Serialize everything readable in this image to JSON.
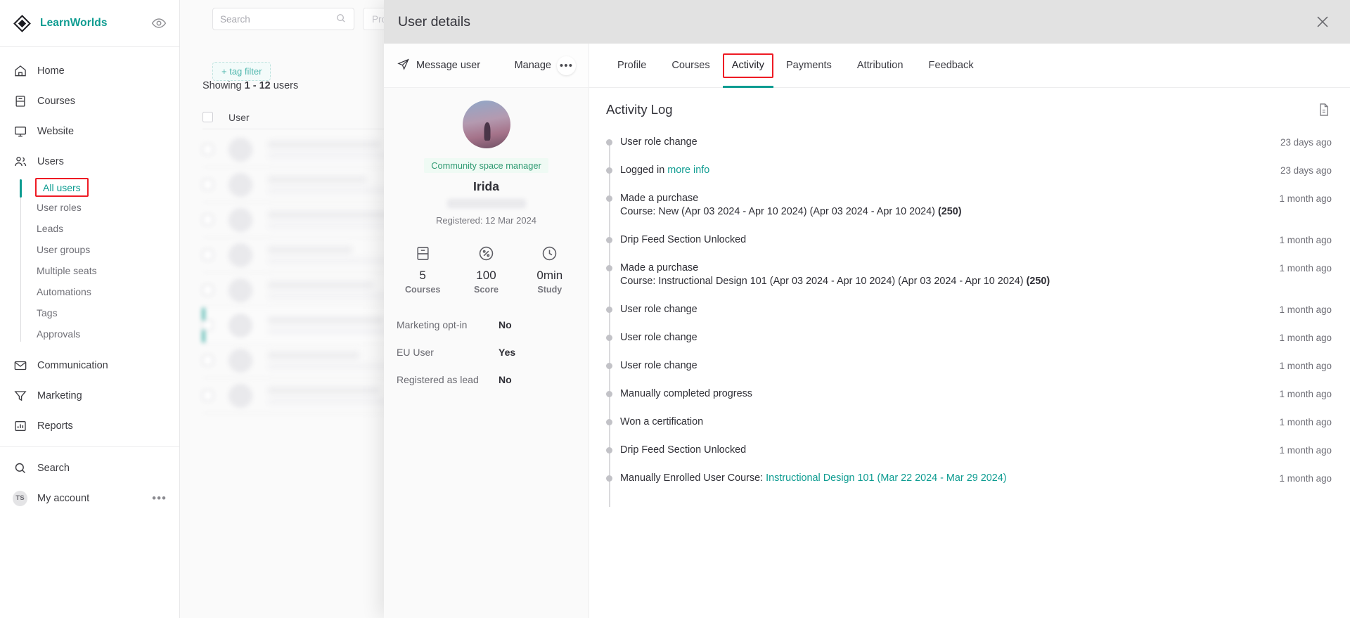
{
  "brand": {
    "name": "LearnWorlds",
    "logo_icon": "learnworlds-logo-icon",
    "preview_icon": "eye-icon",
    "accent": "#0e9c91"
  },
  "sidebar": {
    "items": [
      {
        "label": "Home",
        "icon": "home-icon"
      },
      {
        "label": "Courses",
        "icon": "book-icon"
      },
      {
        "label": "Website",
        "icon": "monitor-icon"
      },
      {
        "label": "Users",
        "icon": "users-icon"
      }
    ],
    "user_subitems": [
      {
        "label": "All users",
        "active": true,
        "highlighted": true
      },
      {
        "label": "User roles"
      },
      {
        "label": "Leads"
      },
      {
        "label": "User groups"
      },
      {
        "label": "Multiple seats"
      },
      {
        "label": "Automations"
      },
      {
        "label": "Tags"
      },
      {
        "label": "Approvals"
      }
    ],
    "items_bottom": [
      {
        "label": "Communication",
        "icon": "envelope-icon"
      },
      {
        "label": "Marketing",
        "icon": "funnel-icon"
      },
      {
        "label": "Reports",
        "icon": "bar-chart-icon"
      }
    ],
    "items_footer": [
      {
        "label": "Search",
        "icon": "search-icon"
      }
    ],
    "account": {
      "label": "My account",
      "initials": "TS",
      "more_icon": "ellipsis-icon"
    }
  },
  "background": {
    "search_placeholder": "Search",
    "search_icon": "search-icon",
    "filter_pill": "Pro",
    "tag_filter": "+ tag filter",
    "showing_prefix": "Showing ",
    "showing_count": "1 - 12",
    "showing_suffix": " users",
    "column_user": "User"
  },
  "panel": {
    "title": "User details",
    "close_icon": "close-icon",
    "message_user": "Message user",
    "message_icon": "send-icon",
    "manage": "Manage",
    "manage_dots": "•••"
  },
  "profile": {
    "avatar_name": "user-avatar",
    "role_badge": "Community space manager",
    "name": "Irida",
    "registered": "Registered: 12 Mar 2024",
    "stats": [
      {
        "value": "5",
        "label": "Courses",
        "icon": "book-icon"
      },
      {
        "value": "100",
        "label": "Score",
        "icon": "percent-circle-icon"
      },
      {
        "value": "0min",
        "label": "Study",
        "icon": "clock-icon"
      }
    ],
    "fields": [
      {
        "key": "Marketing opt-in",
        "value": "No"
      },
      {
        "key": "EU User",
        "value": "Yes"
      },
      {
        "key": "Registered as lead",
        "value": "No"
      }
    ]
  },
  "tabs": [
    {
      "label": "Profile",
      "active": false,
      "highlighted": false
    },
    {
      "label": "Courses",
      "active": false,
      "highlighted": false
    },
    {
      "label": "Activity",
      "active": true,
      "highlighted": true
    },
    {
      "label": "Payments",
      "active": false,
      "highlighted": false
    },
    {
      "label": "Attribution",
      "active": false,
      "highlighted": false
    },
    {
      "label": "Feedback",
      "active": false,
      "highlighted": false
    }
  ],
  "activity_log": {
    "title": "Activity Log",
    "export_icon": "export-file-icon",
    "entries": [
      {
        "text": "User role change",
        "time": "23 days ago"
      },
      {
        "text": "Logged in ",
        "link": "more info",
        "time": "23 days ago"
      },
      {
        "text": "Made a purchase",
        "detail": "Course: New (Apr 03 2024 - Apr 10 2024) (Apr 03 2024 - Apr 10 2024) ",
        "amount": "(250)",
        "time": "1 month ago"
      },
      {
        "text": "Drip Feed Section Unlocked",
        "time": "1 month ago"
      },
      {
        "text": "Made a purchase",
        "detail": "Course: Instructional Design 101 (Apr 03 2024 - Apr 10 2024) (Apr 03 2024 - Apr 10 2024) ",
        "amount": "(250)",
        "time": "1 month ago"
      },
      {
        "text": "User role change",
        "time": "1 month ago"
      },
      {
        "text": "User role change",
        "time": "1 month ago"
      },
      {
        "text": "User role change",
        "time": "1 month ago"
      },
      {
        "text": "Manually completed progress",
        "time": "1 month ago"
      },
      {
        "text": "Won a certification",
        "time": "1 month ago"
      },
      {
        "text": "Drip Feed Section Unlocked",
        "time": "1 month ago"
      },
      {
        "text": "Manually Enrolled User Course: ",
        "link": "Instructional Design 101 (Mar 22 2024 - Mar 29 2024)",
        "time": "1 month ago"
      }
    ]
  }
}
